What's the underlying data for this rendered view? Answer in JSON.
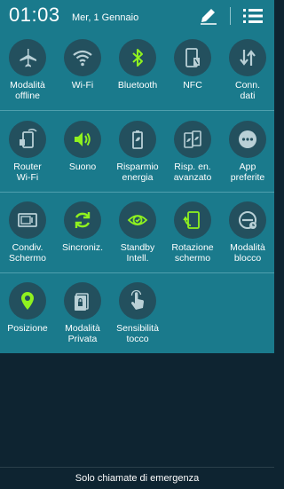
{
  "status": {
    "time": "01:03",
    "date": "Mer, 1 Gennaio"
  },
  "colors": {
    "panel": "#1a7a8c",
    "active": "#8ff21f",
    "inactive": "#b9d0d6",
    "background": "#0e2431"
  },
  "tiles": [
    {
      "label": "Modalità\noffline",
      "icon": "airplane-icon",
      "active": false
    },
    {
      "label": "Wi-Fi",
      "icon": "wifi-icon",
      "active": false
    },
    {
      "label": "Bluetooth",
      "icon": "bluetooth-icon",
      "active": true
    },
    {
      "label": "NFC",
      "icon": "nfc-icon",
      "active": false
    },
    {
      "label": "Conn.\ndati",
      "icon": "data-connection-icon",
      "active": false
    },
    {
      "label": "Router\nWi-Fi",
      "icon": "router-icon",
      "active": false
    },
    {
      "label": "Suono",
      "icon": "sound-icon",
      "active": true
    },
    {
      "label": "Risparmio\nenergia",
      "icon": "battery-saver-icon",
      "active": false
    },
    {
      "label": "Risp. en.\navanzato",
      "icon": "battery-advanced-icon",
      "active": false
    },
    {
      "label": "App\npreferite",
      "icon": "more-apps-icon",
      "active": false
    },
    {
      "label": "Condiv.\nSchermo",
      "icon": "screen-share-icon",
      "active": false
    },
    {
      "label": "Sincroniz.",
      "icon": "sync-icon",
      "active": true
    },
    {
      "label": "Standby\nIntell.",
      "icon": "smart-stay-icon",
      "active": true
    },
    {
      "label": "Rotazione\nschermo",
      "icon": "rotation-icon",
      "active": true
    },
    {
      "label": "Modalità\nblocco",
      "icon": "block-mode-icon",
      "active": false
    },
    {
      "label": "Posizione",
      "icon": "location-icon",
      "active": true
    },
    {
      "label": "Modalità\nPrivata",
      "icon": "private-mode-icon",
      "active": false
    },
    {
      "label": "Sensibilità\ntocco",
      "icon": "touch-sensitivity-icon",
      "active": false
    }
  ],
  "footer": {
    "text": "Solo chiamate di emergenza"
  }
}
